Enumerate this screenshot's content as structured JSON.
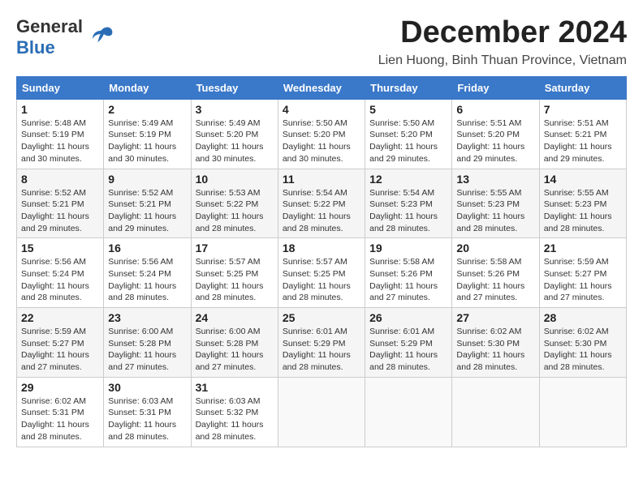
{
  "header": {
    "logo_general": "General",
    "logo_blue": "Blue",
    "title": "December 2024",
    "subtitle": "Lien Huong, Binh Thuan Province, Vietnam"
  },
  "calendar": {
    "headers": [
      "Sunday",
      "Monday",
      "Tuesday",
      "Wednesday",
      "Thursday",
      "Friday",
      "Saturday"
    ],
    "weeks": [
      [
        {
          "day": "1",
          "info": "Sunrise: 5:48 AM\nSunset: 5:19 PM\nDaylight: 11 hours\nand 30 minutes."
        },
        {
          "day": "2",
          "info": "Sunrise: 5:49 AM\nSunset: 5:19 PM\nDaylight: 11 hours\nand 30 minutes."
        },
        {
          "day": "3",
          "info": "Sunrise: 5:49 AM\nSunset: 5:20 PM\nDaylight: 11 hours\nand 30 minutes."
        },
        {
          "day": "4",
          "info": "Sunrise: 5:50 AM\nSunset: 5:20 PM\nDaylight: 11 hours\nand 30 minutes."
        },
        {
          "day": "5",
          "info": "Sunrise: 5:50 AM\nSunset: 5:20 PM\nDaylight: 11 hours\nand 29 minutes."
        },
        {
          "day": "6",
          "info": "Sunrise: 5:51 AM\nSunset: 5:20 PM\nDaylight: 11 hours\nand 29 minutes."
        },
        {
          "day": "7",
          "info": "Sunrise: 5:51 AM\nSunset: 5:21 PM\nDaylight: 11 hours\nand 29 minutes."
        }
      ],
      [
        {
          "day": "8",
          "info": "Sunrise: 5:52 AM\nSunset: 5:21 PM\nDaylight: 11 hours\nand 29 minutes."
        },
        {
          "day": "9",
          "info": "Sunrise: 5:52 AM\nSunset: 5:21 PM\nDaylight: 11 hours\nand 29 minutes."
        },
        {
          "day": "10",
          "info": "Sunrise: 5:53 AM\nSunset: 5:22 PM\nDaylight: 11 hours\nand 28 minutes."
        },
        {
          "day": "11",
          "info": "Sunrise: 5:54 AM\nSunset: 5:22 PM\nDaylight: 11 hours\nand 28 minutes."
        },
        {
          "day": "12",
          "info": "Sunrise: 5:54 AM\nSunset: 5:23 PM\nDaylight: 11 hours\nand 28 minutes."
        },
        {
          "day": "13",
          "info": "Sunrise: 5:55 AM\nSunset: 5:23 PM\nDaylight: 11 hours\nand 28 minutes."
        },
        {
          "day": "14",
          "info": "Sunrise: 5:55 AM\nSunset: 5:23 PM\nDaylight: 11 hours\nand 28 minutes."
        }
      ],
      [
        {
          "day": "15",
          "info": "Sunrise: 5:56 AM\nSunset: 5:24 PM\nDaylight: 11 hours\nand 28 minutes."
        },
        {
          "day": "16",
          "info": "Sunrise: 5:56 AM\nSunset: 5:24 PM\nDaylight: 11 hours\nand 28 minutes."
        },
        {
          "day": "17",
          "info": "Sunrise: 5:57 AM\nSunset: 5:25 PM\nDaylight: 11 hours\nand 28 minutes."
        },
        {
          "day": "18",
          "info": "Sunrise: 5:57 AM\nSunset: 5:25 PM\nDaylight: 11 hours\nand 28 minutes."
        },
        {
          "day": "19",
          "info": "Sunrise: 5:58 AM\nSunset: 5:26 PM\nDaylight: 11 hours\nand 27 minutes."
        },
        {
          "day": "20",
          "info": "Sunrise: 5:58 AM\nSunset: 5:26 PM\nDaylight: 11 hours\nand 27 minutes."
        },
        {
          "day": "21",
          "info": "Sunrise: 5:59 AM\nSunset: 5:27 PM\nDaylight: 11 hours\nand 27 minutes."
        }
      ],
      [
        {
          "day": "22",
          "info": "Sunrise: 5:59 AM\nSunset: 5:27 PM\nDaylight: 11 hours\nand 27 minutes."
        },
        {
          "day": "23",
          "info": "Sunrise: 6:00 AM\nSunset: 5:28 PM\nDaylight: 11 hours\nand 27 minutes."
        },
        {
          "day": "24",
          "info": "Sunrise: 6:00 AM\nSunset: 5:28 PM\nDaylight: 11 hours\nand 27 minutes."
        },
        {
          "day": "25",
          "info": "Sunrise: 6:01 AM\nSunset: 5:29 PM\nDaylight: 11 hours\nand 28 minutes."
        },
        {
          "day": "26",
          "info": "Sunrise: 6:01 AM\nSunset: 5:29 PM\nDaylight: 11 hours\nand 28 minutes."
        },
        {
          "day": "27",
          "info": "Sunrise: 6:02 AM\nSunset: 5:30 PM\nDaylight: 11 hours\nand 28 minutes."
        },
        {
          "day": "28",
          "info": "Sunrise: 6:02 AM\nSunset: 5:30 PM\nDaylight: 11 hours\nand 28 minutes."
        }
      ],
      [
        {
          "day": "29",
          "info": "Sunrise: 6:02 AM\nSunset: 5:31 PM\nDaylight: 11 hours\nand 28 minutes."
        },
        {
          "day": "30",
          "info": "Sunrise: 6:03 AM\nSunset: 5:31 PM\nDaylight: 11 hours\nand 28 minutes."
        },
        {
          "day": "31",
          "info": "Sunrise: 6:03 AM\nSunset: 5:32 PM\nDaylight: 11 hours\nand 28 minutes."
        },
        {
          "day": "",
          "info": ""
        },
        {
          "day": "",
          "info": ""
        },
        {
          "day": "",
          "info": ""
        },
        {
          "day": "",
          "info": ""
        }
      ]
    ]
  }
}
